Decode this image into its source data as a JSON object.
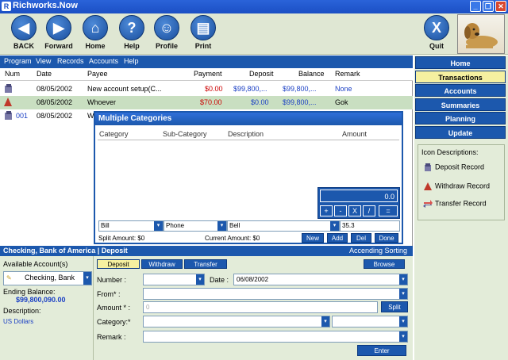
{
  "window": {
    "title": "Richworks.Now",
    "app_icon": "R"
  },
  "toolbar": {
    "buttons": [
      {
        "label": "BACK",
        "icon": "back-icon",
        "glyph": "◀"
      },
      {
        "label": "Forward",
        "icon": "forward-icon",
        "glyph": "▶"
      },
      {
        "label": "Home",
        "icon": "home-icon",
        "glyph": "⌂"
      },
      {
        "label": "Help",
        "icon": "help-icon",
        "glyph": "?"
      },
      {
        "label": "Profile",
        "icon": "profile-icon",
        "glyph": "☺"
      },
      {
        "label": "Print",
        "icon": "print-icon",
        "glyph": "▤"
      }
    ],
    "quit_label": "Quit",
    "quit_glyph": "X"
  },
  "menu": [
    "Program",
    "View",
    "Records",
    "Accounts",
    "Help"
  ],
  "table": {
    "headers": [
      "Num",
      "Date",
      "Payee",
      "Payment",
      "Deposit",
      "Balance",
      "Remark"
    ],
    "rows": [
      {
        "num": "",
        "date": "08/05/2002",
        "payee": "New account setup(C...",
        "payment": "$0.00",
        "deposit": "$99,800,...",
        "balance": "$99,800,...",
        "remark": "None"
      },
      {
        "num": "",
        "date": "08/05/2002",
        "payee": "Whoever",
        "payment": "$70.00",
        "deposit": "$0.00",
        "balance": "$99,800,...",
        "remark": "Gok"
      },
      {
        "num": "001",
        "date": "08/05/2002",
        "payee": "W",
        "payment": "",
        "deposit": "",
        "balance": "",
        "remark": ""
      }
    ]
  },
  "sidebar": {
    "nav": [
      "Home",
      "Transactions",
      "Accounts",
      "Summaries",
      "Planning",
      "Update"
    ],
    "active": "Transactions",
    "icon_desc_title": "Icon Descriptions:",
    "icon_desc": [
      "Deposit Record",
      "Withdraw Record",
      "Transfer Record"
    ]
  },
  "dialog": {
    "title": "Multiple Categories",
    "columns": [
      "Category",
      "Sub-Category",
      "Description",
      "Amount"
    ],
    "calc_display": "0.0",
    "calc_keys": [
      "+",
      "-",
      "X",
      "/",
      "="
    ],
    "category_value": "Bill",
    "subcategory_value": "Phone",
    "description_value": "Bell",
    "amount_value": "35.3",
    "split_amount": "Split Amount: $0",
    "current_amount": "Current Amount: $0",
    "buttons": [
      "New",
      "Add",
      "Del",
      "Done"
    ]
  },
  "account_bar": {
    "title": "Checking, Bank of America | Deposit",
    "sorting": "Accending Sorting"
  },
  "left_panel": {
    "available_label": "Available Account(s)",
    "account_value": "Checking, Bank",
    "ending_label": "Ending Balance:",
    "ending_value": "$99,800,090.00",
    "desc_label": "Description:",
    "desc_value": "US Dollars"
  },
  "form": {
    "tabs": [
      "Deposit",
      "Withdraw",
      "Transfer"
    ],
    "active_tab": "Deposit",
    "browse_label": "Browse",
    "number_label": "Number :",
    "date_label": "Date :",
    "date_value": "06/08/2002",
    "from_label": "From* :",
    "amount_label": "Amount * :",
    "amount_placeholder": "0",
    "split_label": "Split",
    "category_label": "Category:*",
    "remark_label": "Remark :",
    "enter_label": "Enter"
  },
  "colors": {
    "accent": "#1c58ad",
    "panel": "#e3ecd9",
    "selected_row": "#c9dfc1",
    "active_nav": "#f5f0a0",
    "payment_red": "#cc0000",
    "deposit_blue": "#1a3fc4"
  }
}
